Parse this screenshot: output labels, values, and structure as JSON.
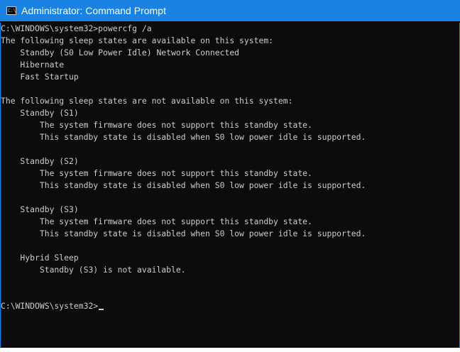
{
  "window": {
    "title": "Administrator: Command Prompt",
    "icon": "console-icon",
    "icon_glyph": "C:\\",
    "colors": {
      "titlebar": "#1a82e2",
      "background": "#0c0c0c",
      "text": "#cccccc"
    }
  },
  "console": {
    "lines": [
      "C:\\WINDOWS\\system32>powercfg /a",
      "The following sleep states are available on this system:",
      "    Standby (S0 Low Power Idle) Network Connected",
      "    Hibernate",
      "    Fast Startup",
      "",
      "The following sleep states are not available on this system:",
      "    Standby (S1)",
      "        The system firmware does not support this standby state.",
      "        This standby state is disabled when S0 low power idle is supported.",
      "",
      "    Standby (S2)",
      "        The system firmware does not support this standby state.",
      "        This standby state is disabled when S0 low power idle is supported.",
      "",
      "    Standby (S3)",
      "        The system firmware does not support this standby state.",
      "        This standby state is disabled when S0 low power idle is supported.",
      "",
      "    Hybrid Sleep",
      "        Standby (S3) is not available.",
      "",
      ""
    ],
    "prompt": "C:\\WINDOWS\\system32>"
  }
}
